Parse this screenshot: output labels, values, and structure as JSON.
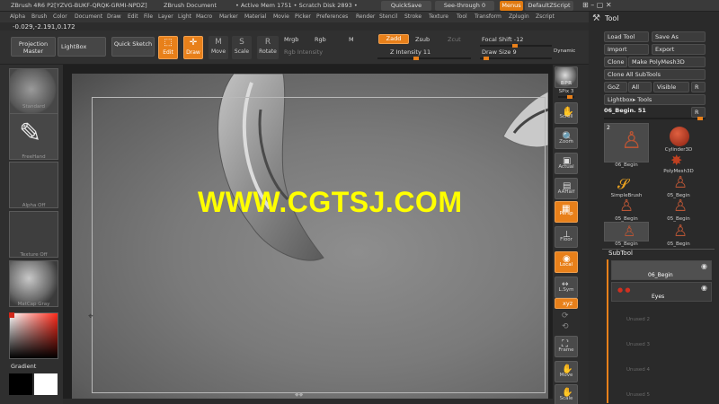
{
  "titlebar": {
    "app": "ZBrush 4R6 P2[YZVG-BUKF-QRQK-GRMI-NPDZ]",
    "doc": "ZBrush Document",
    "mem": "• Active Mem 1751 • Scratch Disk 2893 •",
    "quicksave": "QuickSave",
    "seethrough": "See-through",
    "seethrough_value": "0",
    "menus": "Menus",
    "zscript": "DefaultZScript"
  },
  "menus": [
    "Alpha",
    "Brush",
    "Color",
    "Document",
    "Draw",
    "Edit",
    "File",
    "Layer",
    "Light",
    "Macro",
    "Marker",
    "Material",
    "Movie",
    "Picker",
    "Preferences",
    "Render",
    "Stencil",
    "Stroke",
    "Texture",
    "Tool",
    "Transform",
    "Zplugin",
    "Zscript"
  ],
  "coords": "-0.029,-2.191,0.172",
  "toolbar": {
    "projection_master": "Projection Master",
    "lightbox": "LightBox",
    "quick_sketch": "Quick Sketch",
    "edit": "Edit",
    "draw": "Draw",
    "move": "Move",
    "scale": "Scale",
    "rotate": "Rotate",
    "mrgb": "Mrgb",
    "rgb": "Rgb",
    "m": "M",
    "zadd": "Zadd",
    "zsub": "Zsub",
    "zcut": "Zcut",
    "rgb_intensity": "Rgb Intensity",
    "z_intensity": "Z Intensity 11",
    "focal_shift": "Focal Shift -12",
    "draw_size": "Draw Size 9",
    "dynamic": "Dynamic"
  },
  "left": {
    "materials": [
      {
        "label": "Standard"
      },
      {
        "label": "FreeHand"
      },
      {
        "label": "Alpha Off"
      },
      {
        "label": "Texture Off"
      },
      {
        "label": "MatCap Gray"
      }
    ],
    "gradient": "Gradient",
    "colors": {
      "primary": "#d3271a",
      "white": "#ffffff",
      "black": "#000000"
    }
  },
  "viewport": {
    "watermark": "WWW.CGTSJ.COM"
  },
  "dock": {
    "bpr": "BPR",
    "spix": "SPix 3",
    "scroll": "Scroll",
    "zoom": "Zoom",
    "actual": "Actual",
    "aahalf": "AAHalf",
    "persp": "Persp",
    "floor": "Floor",
    "local": "Local",
    "lsym": "L.Sym",
    "xyz": "xyz",
    "frame": "Frame",
    "move": "Move",
    "scale": "Scale"
  },
  "tool": {
    "header": "Tool",
    "load_tool": "Load Tool",
    "save_as": "Save As",
    "import": "Import",
    "export": "Export",
    "clone": "Clone",
    "make_polymesh": "Make PolyMesh3D",
    "clone_all": "Clone All SubTools",
    "goz": "GoZ",
    "all": "All",
    "visible": "Visible",
    "r": "R",
    "lightbox_tools": "Lightbox▸ Tools",
    "current": "06_Begin. 51",
    "items": [
      {
        "label": "06_Begin",
        "count": "2"
      },
      {
        "label": "Cylinder3D",
        "count": ""
      },
      {
        "label": "PolyMesh3D",
        "count": ""
      },
      {
        "label": "SimpleBrush",
        "count": ""
      },
      {
        "label": "05_Begin",
        "count": "2"
      },
      {
        "label": "05_Begin",
        "count": "2"
      },
      {
        "label": "05_Begin",
        "count": "2"
      },
      {
        "label": "05_Begin",
        "count": ""
      }
    ],
    "subtool_header": "SubTool",
    "subtools": [
      {
        "label": "06_Begin"
      },
      {
        "label": "Eyes"
      }
    ],
    "unused": [
      "Unused 2",
      "Unused 3",
      "Unused 4",
      "Unused 5"
    ]
  }
}
